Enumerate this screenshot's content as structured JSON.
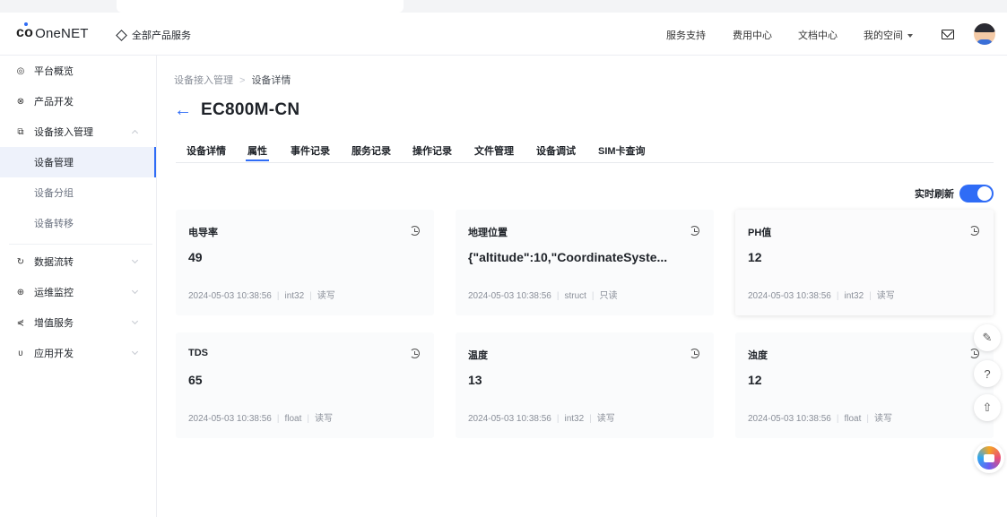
{
  "header": {
    "logo": "OneNET",
    "all_products": "全部产品服务",
    "links": [
      "服务支持",
      "费用中心",
      "文档中心",
      "我的空间"
    ]
  },
  "sidebar": {
    "items": [
      {
        "label": "平台概览",
        "icon": "overview-icon"
      },
      {
        "label": "产品开发",
        "icon": "product-icon"
      },
      {
        "label": "设备接入管理",
        "icon": "device-access-icon"
      },
      {
        "label": "数据流转",
        "icon": "data-flow-icon"
      },
      {
        "label": "运维监控",
        "icon": "monitor-icon"
      },
      {
        "label": "增值服务",
        "icon": "value-added-icon"
      },
      {
        "label": "应用开发",
        "icon": "app-dev-icon"
      }
    ],
    "sub_items": [
      "设备管理",
      "设备分组",
      "设备转移"
    ]
  },
  "breadcrumb": {
    "parent": "设备接入管理",
    "separator": ">",
    "current": "设备详情"
  },
  "device": {
    "name": "EC800M-CN"
  },
  "tabs": [
    "设备详情",
    "属性",
    "事件记录",
    "服务记录",
    "操作记录",
    "文件管理",
    "设备调试",
    "SIM卡查询"
  ],
  "active_tab": "属性",
  "realtime": {
    "label": "实时刷新",
    "enabled": true
  },
  "cards": [
    {
      "name": "电导率",
      "value": "49",
      "time": "2024-05-03 10:38:56",
      "type": "int32",
      "access": "读写"
    },
    {
      "name": "地理位置",
      "value": "{\"altitude\":10,\"CoordinateSyste...",
      "time": "2024-05-03 10:38:56",
      "type": "struct",
      "access": "只读"
    },
    {
      "name": "PH值",
      "value": "12",
      "time": "2024-05-03 10:38:56",
      "type": "int32",
      "access": "读写"
    },
    {
      "name": "TDS",
      "value": "65",
      "time": "2024-05-03 10:38:56",
      "type": "float",
      "access": "读写"
    },
    {
      "name": "温度",
      "value": "13",
      "time": "2024-05-03 10:38:56",
      "type": "int32",
      "access": "读写"
    },
    {
      "name": "浊度",
      "value": "12",
      "time": "2024-05-03 10:38:56",
      "type": "float",
      "access": "读写"
    }
  ],
  "colors": {
    "accent": "#2f6cf6",
    "text": "#1f2329",
    "muted": "#8a8f99"
  }
}
